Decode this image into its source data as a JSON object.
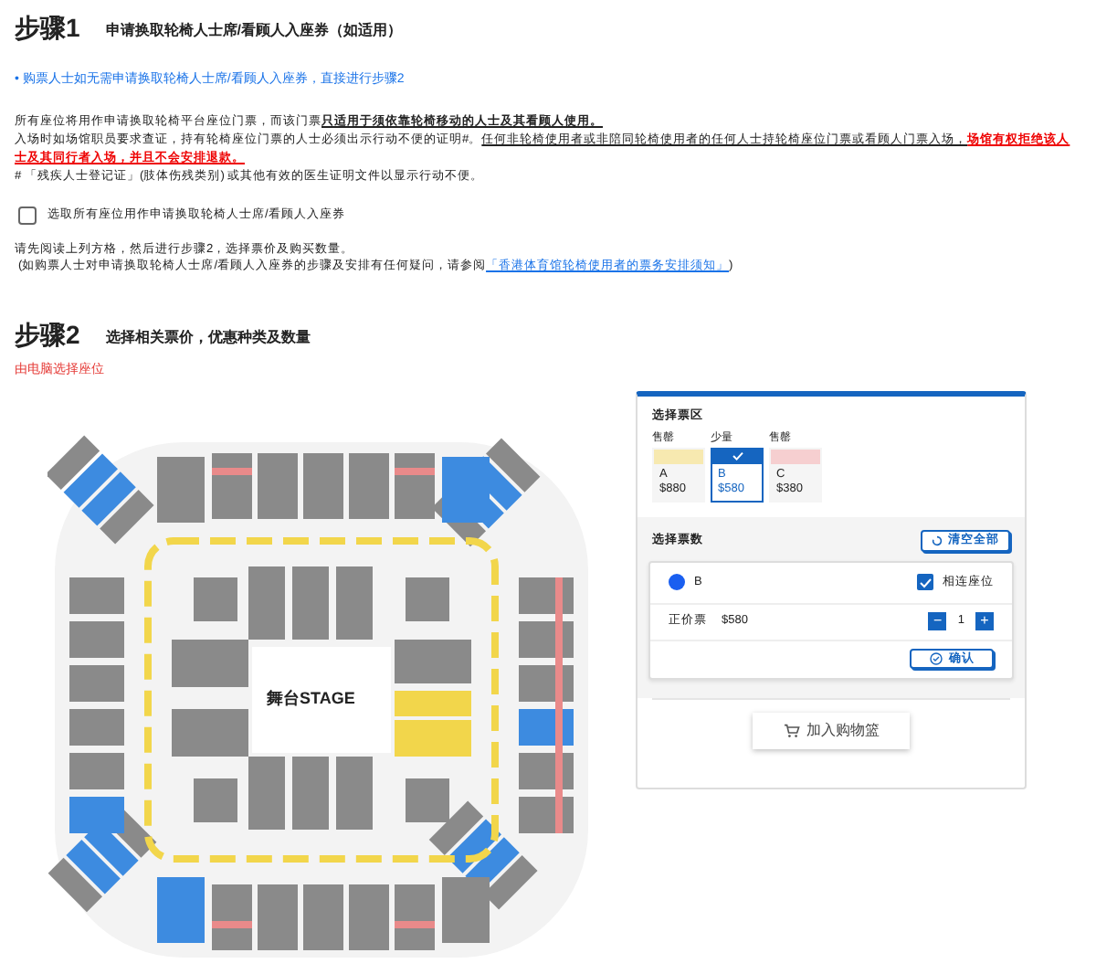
{
  "step1": {
    "label": "步骤1",
    "title": "申请换取轮椅人士席/看顾人入座券（如适用）",
    "note": "• 购票人士如无需申请换取轮椅人士席/看顾人入座券，直接进行步骤2",
    "rules": [
      [
        {
          "kind": "plain",
          "text": "所有座位将用作申请换取轮椅平台座位门票，而该门票"
        },
        {
          "kind": "emphasis",
          "text": "只适用于须依靠轮椅移动的人士及其看顾人使用。"
        }
      ],
      [
        {
          "kind": "plain",
          "text": "入场时如场馆职员要求查证，持有轮椅座位门票的人士必须出示行动不便的证明#。"
        },
        {
          "kind": "underline",
          "text": "任何非轮椅使用者或非陪同轮椅使用者的任何人士持轮椅座位门票或看顾人门票入场，"
        },
        {
          "kind": "warning",
          "text": "场馆有权拒绝该人士及其同行者入场，并且不会安排退款。"
        }
      ],
      [
        {
          "kind": "plain",
          "text": "# 「残疾人士登记证」(肢体伤残类别) 或其他有效的医生证明文件以显示行动不便。"
        }
      ]
    ],
    "checkbox": {
      "label": "选取所有座位用作申请换取轮椅人士席/看顾人入座券",
      "checked": false
    },
    "instruction": "请先阅读上列方格，然后进行步骤2，选择票价及购买数量。",
    "inquiry": "(如购票人士对申请换取轮椅人士席/看顾人入座券的步骤及安排有任何疑问，请参阅",
    "inquiry_link": "「香港体育馆轮椅使用者的票务安排须知」",
    "inquiry_end": ")"
  },
  "step2": {
    "label": "步骤2",
    "title": "选择相关票价，优惠种类及数量",
    "mode": "由电脑选择座位"
  },
  "seat_map": {
    "stage_label": "舞台STAGE"
  },
  "panel": {
    "zone_title": "选择票区",
    "zones": [
      {
        "availability": "售罄",
        "name": "A",
        "price": "$880",
        "color": "#f7e9b0",
        "selected": false
      },
      {
        "availability": "少量",
        "name": "B",
        "price": "$580",
        "color": "#1565c0",
        "selected": true
      },
      {
        "availability": "售罄",
        "name": "C",
        "price": "$380",
        "color": "#f6cfd0",
        "selected": false
      }
    ],
    "count_title": "选择票数",
    "clear_button": "清空全部",
    "selection": {
      "zone": "B",
      "color": "#1a5ff0",
      "adjacent_label": "相连座位",
      "adjacent": true,
      "ticket_type": "正价票",
      "price": "$580",
      "minus": "−",
      "quantity": "1",
      "plus": "+",
      "confirm": "确认"
    },
    "cart_button": "加入购物篮"
  }
}
